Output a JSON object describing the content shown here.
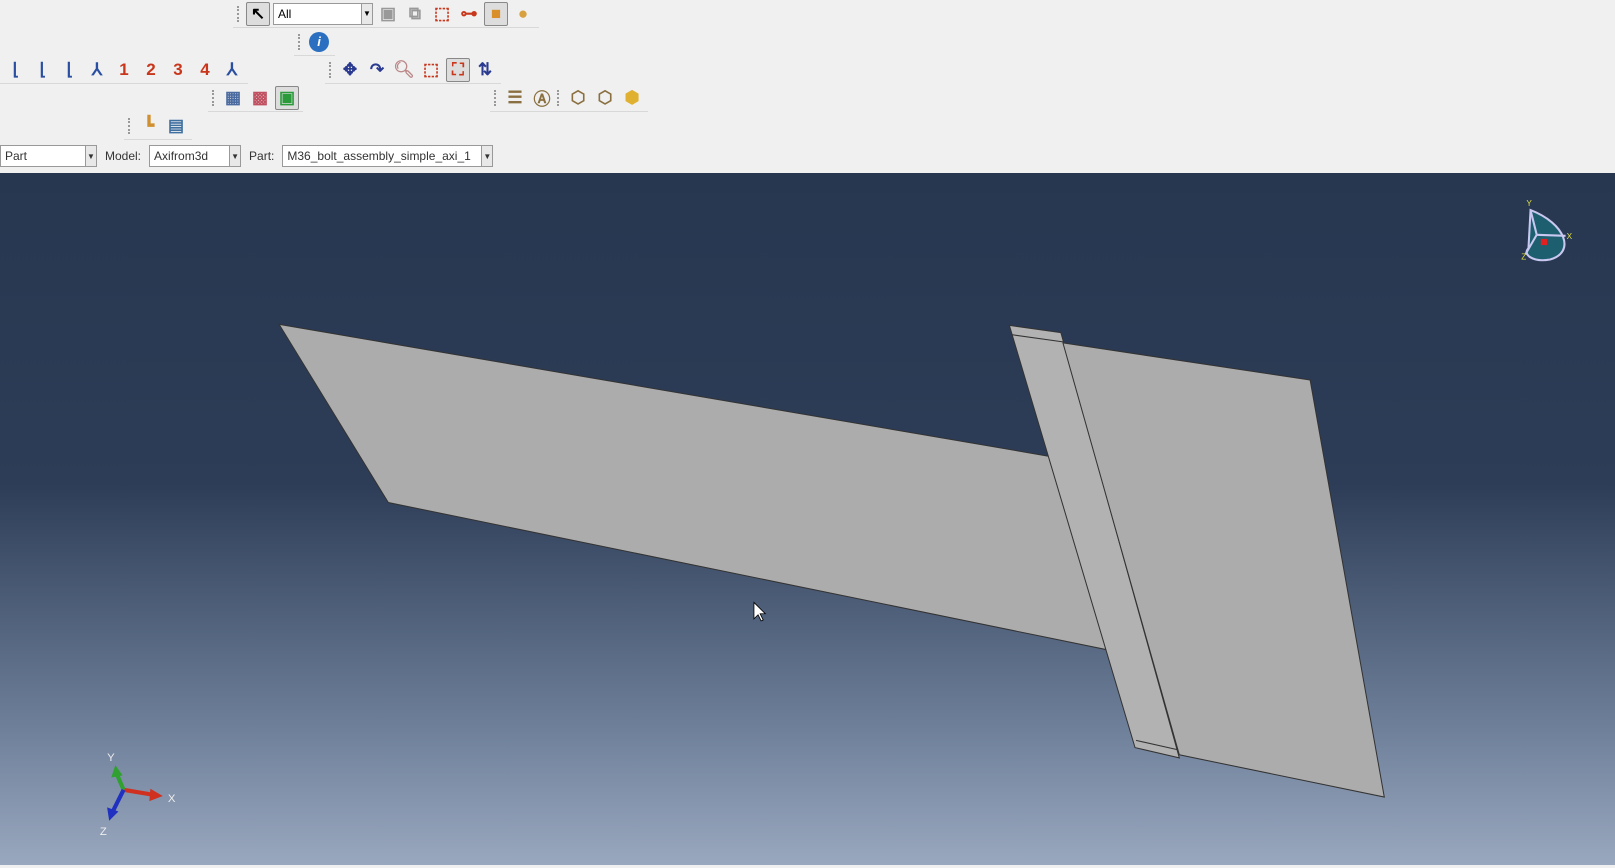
{
  "toolbar": {
    "selection_filter": "All",
    "view_numbers": [
      "1",
      "2",
      "3",
      "4"
    ]
  },
  "context": {
    "module_value": "Part",
    "model_label": "Model:",
    "model_value": "Axifrom3d",
    "part_label": "Part:",
    "part_value": "M36_bolt_assembly_simple_axi_1"
  },
  "triad": {
    "x": "X",
    "y": "Y",
    "z": "Z"
  },
  "colors": {
    "viewport_top": "#283750",
    "viewport_bottom": "#99a8be",
    "part_fill": "#acacac",
    "accent_red": "#c8361c"
  }
}
